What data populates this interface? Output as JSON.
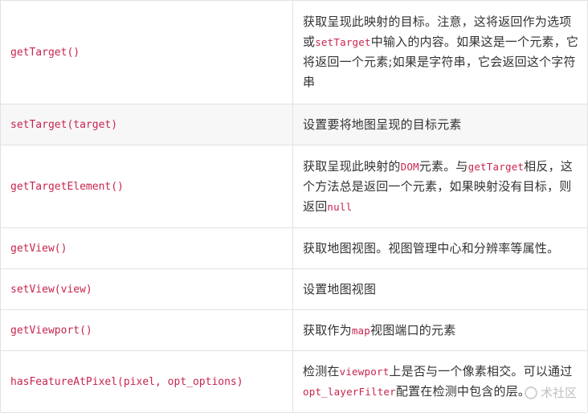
{
  "rows": [
    {
      "method": "getTarget()",
      "desc": [
        {
          "t": "获取呈现此映射的目标。注意，这将返回作为选项或"
        },
        {
          "c": "setTarget"
        },
        {
          "t": "中输入的内容。如果这是一个元素，它将返回一个元素;如果是字符串，它会返回这个字符串"
        }
      ]
    },
    {
      "method": "setTarget(target)",
      "desc": [
        {
          "t": "设置要将地图呈现的目标元素"
        }
      ]
    },
    {
      "method": "getTargetElement()",
      "desc": [
        {
          "t": "获取呈现此映射的"
        },
        {
          "c": "DOM"
        },
        {
          "t": "元素。与"
        },
        {
          "c": "getTarget"
        },
        {
          "t": "相反，这个方法总是返回一个元素，如果映射没有目标，则返回"
        },
        {
          "c": "null"
        }
      ]
    },
    {
      "method": "getView()",
      "desc": [
        {
          "t": "获取地图视图。视图管理中心和分辨率等属性。"
        }
      ]
    },
    {
      "method": "setView(view)",
      "desc": [
        {
          "t": "设置地图视图"
        }
      ]
    },
    {
      "method": "getViewport()",
      "desc": [
        {
          "t": "获取作为"
        },
        {
          "c": "map"
        },
        {
          "t": "视图端口的元素"
        }
      ]
    },
    {
      "method": "hasFeatureAtPixel(pixel, opt_options)",
      "desc": [
        {
          "t": "检测在"
        },
        {
          "c": "viewport"
        },
        {
          "t": "上是否与一个像素相交。可以通过"
        },
        {
          "c": "opt_layerFilter"
        },
        {
          "t": "配置在检测中包含的层。"
        }
      ]
    }
  ],
  "watermark": {
    "text": "术社区"
  }
}
